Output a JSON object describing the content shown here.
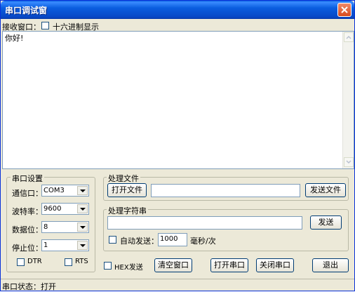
{
  "window": {
    "title": "串口调试窗"
  },
  "receive": {
    "label": "接收窗口：",
    "hex_display_label": "十六进制显示",
    "hex_display_checked": false,
    "content": "你好!"
  },
  "serial_settings": {
    "group_title": "串口设置",
    "port_label": "通信口：",
    "port_value": "COM3",
    "baud_label": "波特率：",
    "baud_value": "9600",
    "databits_label": "数据位：",
    "databits_value": "8",
    "stopbits_label": "停止位：",
    "stopbits_value": "1",
    "dtr_label": "DTR",
    "rts_label": "RTS"
  },
  "file_group": {
    "group_title": "处理文件",
    "open_button": "打开文件",
    "path_value": "",
    "send_button": "发送文件"
  },
  "string_group": {
    "group_title": "处理字符串",
    "text_value": "",
    "send_button": "发送",
    "auto_send_label": "自动发送：",
    "interval_value": "1000",
    "interval_unit": "毫秒/次"
  },
  "bottom": {
    "hex_send_label": "HEX发送",
    "clear_button": "清空窗口",
    "open_port_button": "打开串口",
    "close_port_button": "关闭串口",
    "exit_button": "退出"
  },
  "status": {
    "text": "串口状态：打开"
  }
}
